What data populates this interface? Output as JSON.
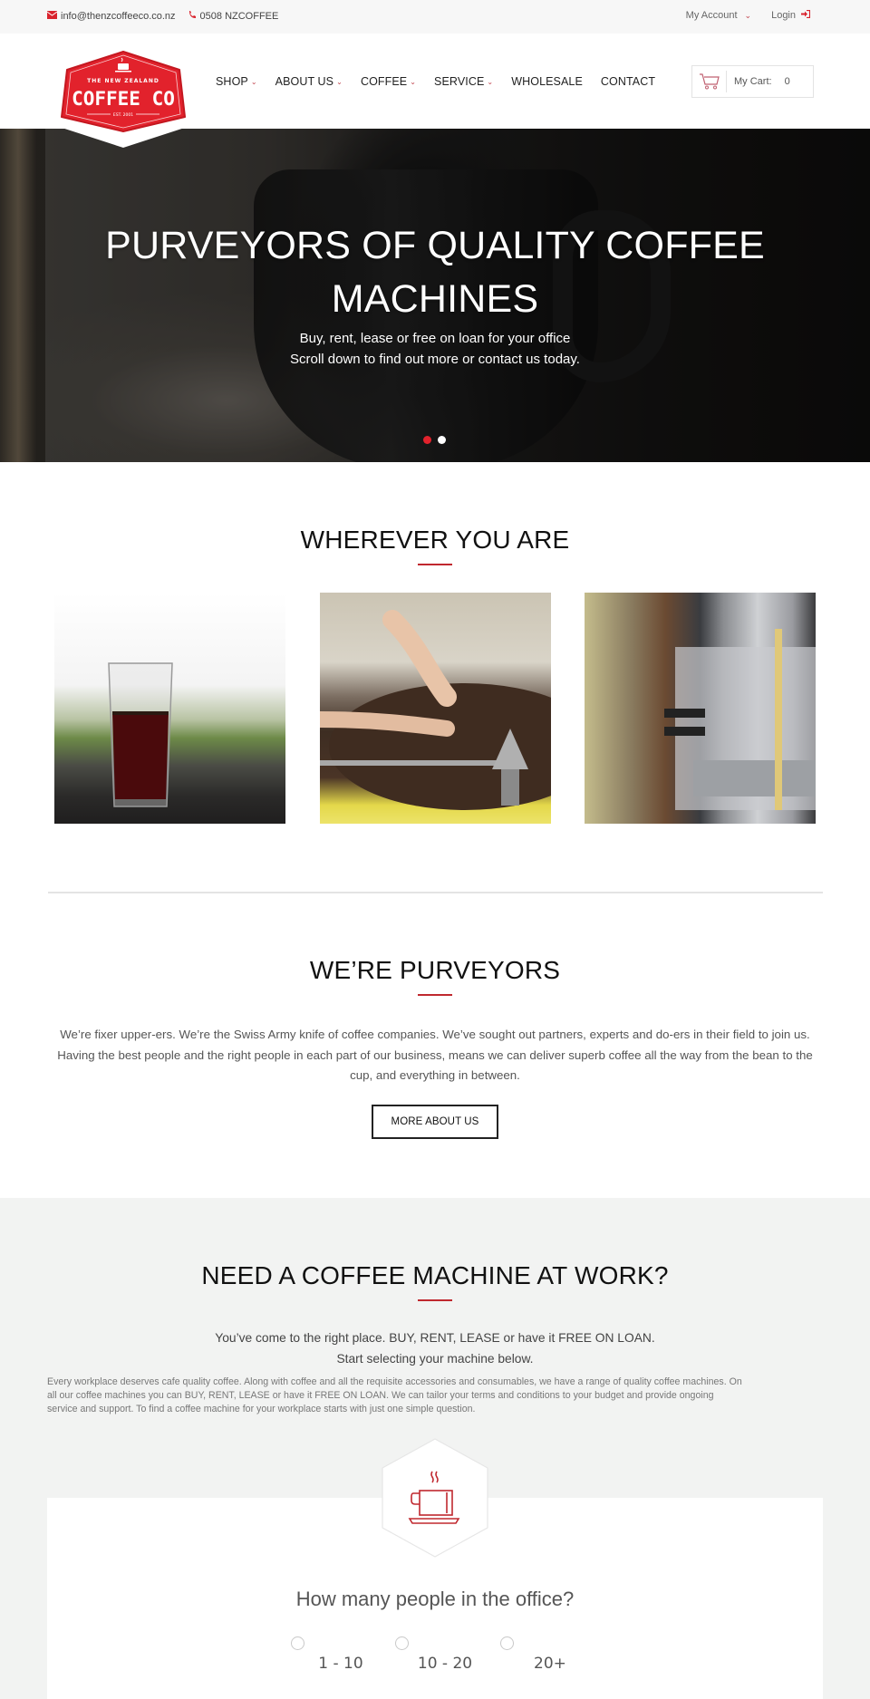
{
  "topbar": {
    "email": "info@thenzcoffeeco.co.nz",
    "phone": "0508 NZCOFFEE",
    "my_account": "My Account",
    "login": "Login"
  },
  "logo": {
    "line1": "THE NEW ZEALAND",
    "line2": "COFFEE CO",
    "line3": "EST. 2001"
  },
  "nav": {
    "items": [
      {
        "label": "SHOP",
        "dropdown": true
      },
      {
        "label": "ABOUT US",
        "dropdown": true
      },
      {
        "label": "COFFEE",
        "dropdown": true
      },
      {
        "label": "SERVICE",
        "dropdown": true
      },
      {
        "label": "WHOLESALE",
        "dropdown": false
      },
      {
        "label": "CONTACT",
        "dropdown": false
      }
    ]
  },
  "cart": {
    "label": "My Cart:",
    "count": "0"
  },
  "hero": {
    "title_line1": "PURVEYORS OF QUALITY COFFEE",
    "title_line2": "MACHINES",
    "sub_line1": "Buy, rent, lease or free on loan for your office",
    "sub_line2": "Scroll down to find out more or contact us today.",
    "slides": 2,
    "active_slide": 1
  },
  "wherever": {
    "title": "WHEREVER YOU ARE",
    "images": [
      "glass-of-coffee-photo",
      "coffee-roaster-beans-photo",
      "espresso-machine-photo"
    ]
  },
  "purveyors": {
    "title": "WE’RE PURVEYORS",
    "body": "We’re fixer upper-ers. We’re the Swiss Army knife of coffee companies. We’ve sought out partners, experts and do-ers in their field to join us. Having the best people and the right people in each part of our business, means we can deliver superb coffee all the way from the bean to the cup, and everything in between.",
    "button": "MORE ABOUT US"
  },
  "machine": {
    "title": "NEED A COFFEE MACHINE AT WORK?",
    "lead_line1": "You’ve come to the right place. BUY, RENT, LEASE or have it FREE ON LOAN.",
    "lead_line2": "Start selecting your machine below.",
    "body": "Every workplace deserves cafe quality coffee. Along with coffee and all the requisite accessories and consumables, we have a range of quality coffee machines. On all our coffee machines you can BUY, RENT, LEASE or have it FREE ON LOAN. We can tailor your terms and conditions to your budget and provide ongoing service and support. To find a coffee machine for your workplace starts with just one simple question.",
    "question": "How many people in the office?",
    "options": [
      "1 - 10",
      "10 - 20",
      "20+"
    ]
  },
  "colors": {
    "brand_red": "#e2222c",
    "accent_red": "#c0282f",
    "grey_bg": "#f2f3f2"
  }
}
